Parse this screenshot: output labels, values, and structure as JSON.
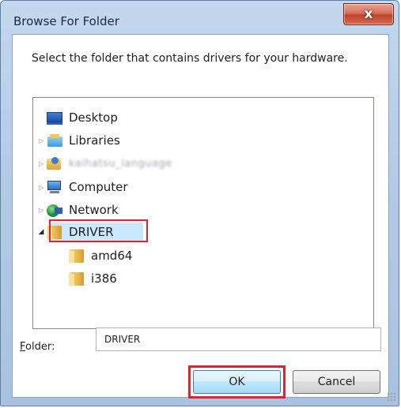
{
  "window": {
    "title": "Browse For Folder",
    "close_glyph": "x"
  },
  "instruction": "Select the folder that contains drivers for your hardware.",
  "tree": {
    "items": [
      {
        "label": "Desktop",
        "icon": "desktop-icon"
      },
      {
        "label": "Libraries",
        "icon": "libraries-icon",
        "arrow": "▷"
      },
      {
        "label": "kaihatsu_language",
        "icon": "user-folder-icon",
        "arrow": "▷"
      },
      {
        "label": "Computer",
        "icon": "computer-icon",
        "arrow": "▷"
      },
      {
        "label": "Network",
        "icon": "network-icon",
        "arrow": "▷"
      },
      {
        "label": "DRIVER",
        "icon": "folder-icon",
        "arrow": "◢",
        "selected": true
      },
      {
        "label": "amd64",
        "icon": "folder-icon"
      },
      {
        "label": "i386",
        "icon": "folder-icon"
      }
    ]
  },
  "folder": {
    "label_underline": "F",
    "label_rest": "older:",
    "value": "DRIVER"
  },
  "buttons": {
    "ok": "OK",
    "cancel": "Cancel"
  },
  "colors": {
    "highlight_red": "#e0242b",
    "selection_blue": "#cce8ff",
    "close_red": "#c0442b"
  }
}
